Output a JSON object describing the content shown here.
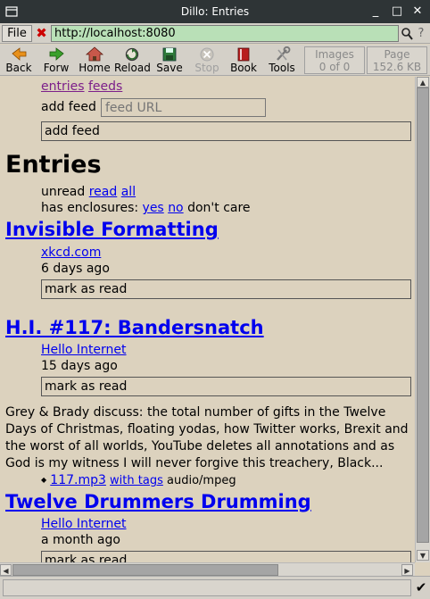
{
  "window": {
    "title": "Dillo: Entries"
  },
  "location": {
    "file_menu": "File",
    "url": "http://localhost:8080"
  },
  "toolbar": {
    "back": "Back",
    "forward": "Forw",
    "home": "Home",
    "reload": "Reload",
    "save": "Save",
    "stop": "Stop",
    "bookmarks": "Book",
    "tools": "Tools",
    "images_label": "Images",
    "images_value": "0 of 0",
    "page_label": "Page",
    "page_value": "152.6 KB"
  },
  "page": {
    "top_links": [
      "entries",
      "feeds"
    ],
    "add_feed_label": "add feed",
    "feed_url_placeholder": "feed URL",
    "add_feed_button": "add feed",
    "heading": "Entries",
    "filter_unread": {
      "prefix": "unread",
      "read": "read",
      "all": "all"
    },
    "filter_enclosures": {
      "prefix": "has enclosures:",
      "yes": "yes",
      "no": "no",
      "dont_care": "don't care"
    },
    "entries": [
      {
        "title": "Invisible Formatting",
        "feed": "xkcd.com",
        "age": "6 days ago",
        "mark_button": "mark as read"
      },
      {
        "title": "H.I. #117: Bandersnatch",
        "feed": "Hello Internet",
        "age": "15 days ago",
        "mark_button": "mark as read",
        "description": [
          "Grey & Brady discuss: the total number of gifts in the Twelve",
          "Days of Christmas, floating yodas, how Twitter works, Brexit and",
          "the worst of all worlds, YouTube deletes all annotations and as",
          "God is my witness I will never forgive this treachery, Black..."
        ],
        "enclosure": {
          "file": "117.mp3",
          "tags": "with tags",
          "mime": "audio/mpeg"
        }
      },
      {
        "title": "Twelve Drummers Drumming",
        "feed": "Hello Internet",
        "age": "a month ago",
        "mark_button": "mark as read"
      }
    ]
  },
  "status": {
    "message": ""
  }
}
